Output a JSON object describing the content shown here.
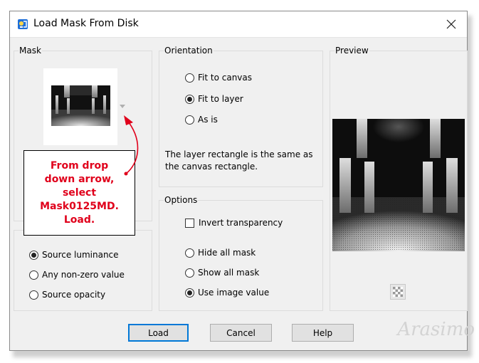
{
  "window": {
    "title": "Load Mask From Disk"
  },
  "mask": {
    "label": "Mask",
    "selected_file": "Mask0125MD"
  },
  "orientation": {
    "label": "Orientation",
    "options": [
      "Fit to canvas",
      "Fit to layer",
      "As is"
    ],
    "selected_index": 1,
    "info_line1": "The layer rectangle is the same as",
    "info_line2": "the canvas rectangle."
  },
  "preview": {
    "label": "Preview"
  },
  "options": {
    "label": "Options",
    "invert_label": "Invert transparency",
    "invert_checked": false,
    "mask_options": [
      "Hide all mask",
      "Show all mask",
      "Use image value"
    ],
    "mask_selected_index": 2
  },
  "create_from": {
    "options": [
      "Source luminance",
      "Any non-zero value",
      "Source opacity"
    ],
    "selected_index": 0
  },
  "buttons": {
    "load": "Load",
    "cancel": "Cancel",
    "help": "Help"
  },
  "callout": {
    "line1": "From drop",
    "line2": "down arrow,",
    "line3": "select",
    "line4": "Mask0125MD.",
    "line5": "Load."
  },
  "watermark": "Arasimo",
  "colors": {
    "accent": "#0078d7",
    "callout_text": "#e0001b",
    "arrow": "#e0001b"
  }
}
